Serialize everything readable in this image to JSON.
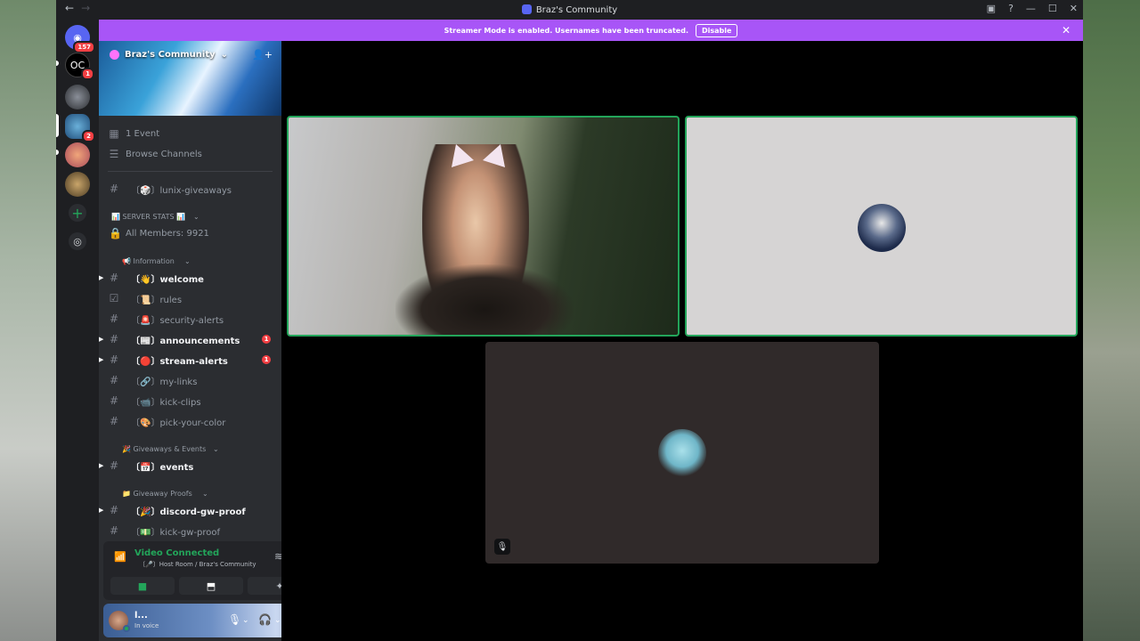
{
  "window": {
    "title": "Braz's Community"
  },
  "banner": {
    "text": "Streamer Mode is enabled. Usernames have been truncated.",
    "button": "Disable"
  },
  "server": {
    "name": "Braz's Community"
  },
  "servers": [
    {
      "badge": "157"
    },
    {
      "badge": "1"
    },
    {
      "badge": ""
    },
    {
      "badge": "2"
    },
    {
      "badge": ""
    },
    {
      "badge": ""
    }
  ],
  "top_items": [
    {
      "label": "1 Event"
    },
    {
      "label": "Browse Channels"
    }
  ],
  "channels": [
    {
      "label": "〔🎲〕lunix-giveaways"
    },
    {
      "label": "All Members: 9921"
    },
    {
      "label": "〔👋〕welcome"
    },
    {
      "label": "〔📜〕rules"
    },
    {
      "label": "〔🚨〕security-alerts"
    },
    {
      "label": "〔📰〕announcements",
      "mention": "1"
    },
    {
      "label": "〔🔴〕stream-alerts",
      "mention": "1"
    },
    {
      "label": "〔🔗〕my-links"
    },
    {
      "label": "〔📹〕kick-clips"
    },
    {
      "label": "〔🎨〕pick-your-color"
    },
    {
      "label": "〔📅〕events"
    },
    {
      "label": "〔🎉〕discord-gw-proof"
    },
    {
      "label": "〔💵〕kick-gw-proof"
    }
  ],
  "categories": [
    {
      "label": "📊 SERVER STATS 📊"
    },
    {
      "label": "📢 Information"
    },
    {
      "label": "🎉 Giveaways & Events"
    },
    {
      "label": "📁 Giveaway Proofs"
    }
  ],
  "voice": {
    "status": "Video Connected",
    "location": "〔🎤〕Host Room / Braz's Community"
  },
  "user": {
    "name": "l...",
    "status": "In voice"
  },
  "colors": {
    "accent": "#a855f7",
    "speaking": "#23a55a",
    "mention": "#f23f43"
  },
  "icons": [
    "back-arrow-icon",
    "forward-arrow-icon",
    "inbox-icon",
    "help-icon",
    "minimize-icon",
    "maximize-icon",
    "close-icon",
    "signal-icon",
    "noise-suppression-icon",
    "disconnect-icon",
    "camera-icon",
    "screen-share-icon",
    "activity-icon",
    "microphone-icon",
    "headphones-icon",
    "settings-icon",
    "mute-icon"
  ]
}
